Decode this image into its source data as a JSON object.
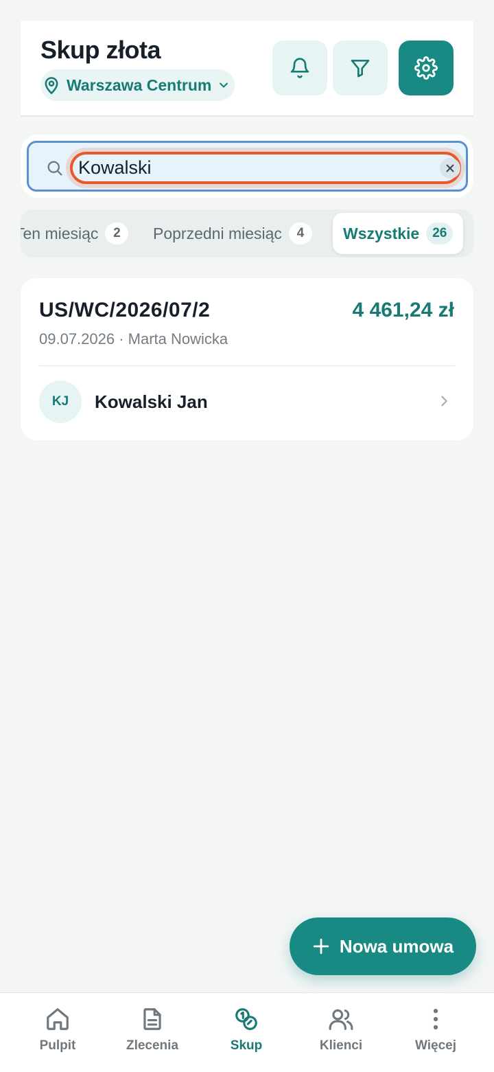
{
  "header": {
    "title": "Skup złota",
    "location": "Warszawa Centrum",
    "buttons": [
      "bell-icon",
      "filter-icon",
      "gear-icon"
    ]
  },
  "search": {
    "value": "Kowalski",
    "placeholder": ""
  },
  "tabs": [
    {
      "label": "Ten miesiąc",
      "count": "2"
    },
    {
      "label": "Poprzedni miesiąc",
      "count": "4"
    },
    {
      "label": "Wszystkie",
      "count": "26",
      "active": true
    }
  ],
  "results": [
    {
      "contract_no": "US/WC/2026/07/2",
      "amount": "4 461,24 zł",
      "meta": "09.07.2026 · Marta Nowicka",
      "initials": "KJ",
      "client": "Kowalski Jan"
    }
  ],
  "fab": {
    "label": "Nowa umowa"
  },
  "nav": [
    {
      "label": "Pulpit",
      "icon": "home-icon"
    },
    {
      "label": "Zlecenia",
      "icon": "document-icon"
    },
    {
      "label": "Skup",
      "icon": "coins-icon",
      "active": true
    },
    {
      "label": "Klienci",
      "icon": "users-icon"
    },
    {
      "label": "Więcej",
      "icon": "more-vertical-icon"
    }
  ],
  "colors": {
    "accent": "#198a83",
    "accent_text": "#177a74",
    "background": "#f4f6f6",
    "focus_ring": "#e85a2b",
    "search_border": "#5b8fd0"
  }
}
